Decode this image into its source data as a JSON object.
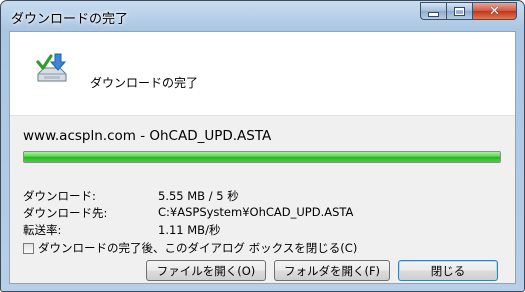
{
  "window": {
    "title": "ダウンロードの完了",
    "buttons": {
      "minimize_icon": "minimize-icon",
      "maximize_icon": "maximize-icon",
      "close_icon": "close-icon",
      "close_glyph": "✕"
    }
  },
  "header": {
    "icon": "download-complete-icon",
    "text": "ダウンロードの完了"
  },
  "download": {
    "filename": "www.acspln.com - OhCAD_UPD.ASTA",
    "progress": 1.0,
    "rows": [
      {
        "label": "ダウンロード:",
        "value": "5.55 MB / 5 秒"
      },
      {
        "label": "ダウンロード先:",
        "value": "C:¥ASPSystem¥OhCAD_UPD.ASTA"
      },
      {
        "label": "転送率:",
        "value": "1.11 MB/秒"
      }
    ],
    "checkbox_label": "ダウンロードの完了後、このダイアログ ボックスを閉じる(C)",
    "checkbox_checked": false
  },
  "actions": {
    "open_file": "ファイルを開く(O)",
    "open_folder": "フォルダを開く(F)",
    "close": "閉じる"
  },
  "colors": {
    "progress_green": "#25b722",
    "title_bar": "#b7cfe8",
    "close_button": "#c1351b"
  }
}
